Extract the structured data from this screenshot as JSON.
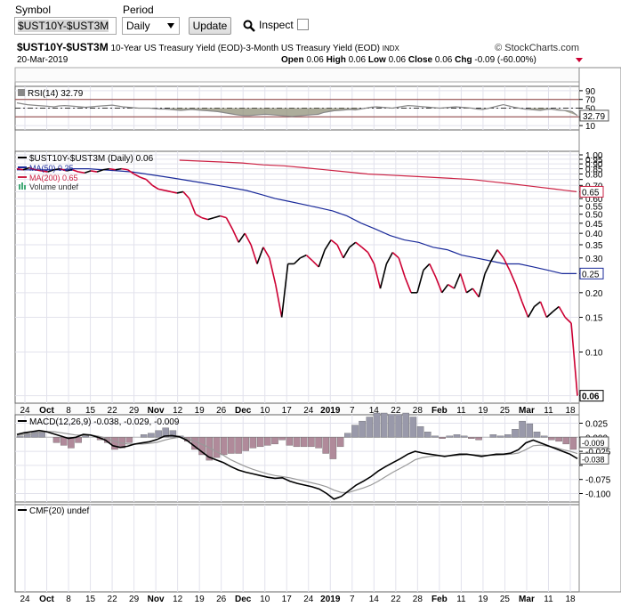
{
  "controls": {
    "symbol_label": "Symbol",
    "symbol_value": "$UST10Y-$UST3M",
    "period_label": "Period",
    "period_value": "Daily",
    "update_label": "Update",
    "inspect_label": "Inspect"
  },
  "header": {
    "symbol": "$UST10Y-$UST3M",
    "description": "10-Year US Treasury Yield (EOD)-3-Month US Treasury Yield (EOD)",
    "exchange": "INDX",
    "brand": "© StockCharts.com",
    "date": "20-Mar-2019",
    "open_label": "Open",
    "open_value": "0.06",
    "high_label": "High",
    "high_value": "0.06",
    "low_label": "Low",
    "low_value": "0.06",
    "close_label": "Close",
    "close_value": "0.06",
    "chg_label": "Chg",
    "chg_value": "-0.09 (-60.00%)"
  },
  "colors": {
    "price": "#000000",
    "price_down": "#cc0033",
    "ma50": "#1a2a9a",
    "ma200": "#cc2244",
    "rsi_line": "#888888",
    "rsi_fill": "#8a8a70",
    "macd_line": "#000000",
    "signal_line": "#999999",
    "hist_pos": "#9999aa",
    "hist_neg": "#b08a9a"
  },
  "chart_data": [
    {
      "type": "line",
      "panel": "RSI",
      "legend": "RSI(14) 32.79",
      "current_label": "32.79",
      "ylim": [
        0,
        100
      ],
      "yticks": [
        "90",
        "70",
        "50",
        "30",
        "10"
      ],
      "reference_lines": [
        70,
        50,
        30
      ],
      "values": [
        62,
        60,
        58,
        57,
        56,
        55,
        54,
        53,
        55,
        56,
        55,
        54,
        53,
        52,
        53,
        54,
        55,
        56,
        57,
        55,
        53,
        52,
        51,
        50,
        50,
        50,
        49,
        48,
        48,
        47,
        46,
        45,
        46,
        47,
        46,
        45,
        44,
        43,
        42,
        40,
        38,
        36,
        34,
        33,
        33,
        34,
        35,
        36,
        35,
        34,
        33,
        32,
        31,
        32,
        33,
        34,
        35,
        36,
        40,
        42,
        44,
        45,
        46,
        47,
        46,
        48,
        50,
        52,
        53,
        52,
        51,
        50,
        52,
        54,
        56,
        55,
        54,
        53,
        52,
        51,
        50,
        51,
        52,
        53,
        52,
        51,
        50,
        48,
        47,
        49,
        52,
        55,
        58,
        55,
        52,
        50,
        48,
        47,
        46,
        45,
        47,
        48,
        46,
        45,
        44,
        42,
        32.79
      ]
    },
    {
      "type": "line",
      "panel": "price",
      "series": [
        {
          "name": "$UST10Y-$UST3M (Daily) 0.06",
          "legend_value": "0.06",
          "values": [
            0.85,
            0.84,
            0.86,
            0.84,
            0.83,
            0.82,
            0.84,
            0.85,
            0.83,
            0.84,
            0.82,
            0.81,
            0.83,
            0.82,
            0.84,
            0.85,
            0.84,
            0.85,
            0.84,
            0.8,
            0.77,
            0.75,
            0.7,
            0.67,
            0.66,
            0.65,
            0.64,
            0.65,
            0.6,
            0.5,
            0.48,
            0.47,
            0.48,
            0.49,
            0.48,
            0.42,
            0.36,
            0.4,
            0.35,
            0.28,
            0.34,
            0.3,
            0.22,
            0.15,
            0.28,
            0.28,
            0.3,
            0.31,
            0.29,
            0.27,
            0.33,
            0.37,
            0.35,
            0.3,
            0.34,
            0.36,
            0.34,
            0.32,
            0.28,
            0.21,
            0.28,
            0.32,
            0.3,
            0.24,
            0.2,
            0.2,
            0.26,
            0.28,
            0.24,
            0.2,
            0.22,
            0.21,
            0.25,
            0.2,
            0.21,
            0.19,
            0.25,
            0.29,
            0.33,
            0.3,
            0.26,
            0.22,
            0.18,
            0.15,
            0.17,
            0.18,
            0.15,
            0.16,
            0.17,
            0.15,
            0.14,
            0.06
          ]
        },
        {
          "name": "MA(50) 0.25",
          "legend_value": "0.25",
          "values": [
            0.84,
            0.84,
            0.84,
            0.84,
            0.85,
            0.85,
            0.84,
            0.83,
            0.82,
            0.8,
            0.78,
            0.76,
            0.74,
            0.72,
            0.7,
            0.68,
            0.66,
            0.63,
            0.6,
            0.58,
            0.56,
            0.54,
            0.52,
            0.49,
            0.45,
            0.42,
            0.39,
            0.37,
            0.36,
            0.34,
            0.33,
            0.31,
            0.3,
            0.29,
            0.28,
            0.28,
            0.27,
            0.26,
            0.25,
            0.25
          ]
        },
        {
          "name": "MA(200) 0.65",
          "legend_value": "0.65",
          "values": [
            0.94,
            0.93,
            0.92,
            0.91,
            0.89,
            0.88,
            0.86,
            0.84,
            0.82,
            0.8,
            0.79,
            0.78,
            0.77,
            0.76,
            0.75,
            0.73,
            0.71,
            0.69,
            0.67,
            0.65
          ]
        },
        {
          "name": "Volume undef"
        }
      ],
      "yticks": [
        "1.00",
        "0.95",
        "0.90",
        "0.85",
        "0.80",
        "0.75",
        "0.70",
        "0.65",
        "0.60",
        "0.55",
        "0.50",
        "0.45",
        "0.40",
        "0.35",
        "0.30",
        "0.25",
        "0.20",
        "0.15",
        "0.10",
        "0.06"
      ],
      "scale": "log"
    },
    {
      "type": "bar",
      "panel": "MACD",
      "legend": "MACD(12,26,9) -0.038, -0.029, -0.009",
      "labels": [
        "-0.009",
        "-0.038"
      ],
      "yticks": [
        "0.025",
        "0.000",
        "-0.025",
        "-0.050",
        "-0.075",
        "-0.100"
      ],
      "ylim": [
        -0.115,
        0.04
      ],
      "macd": [
        0.005,
        0.008,
        0.01,
        0.012,
        0.01,
        0.006,
        0.002,
        -0.002,
        0.0,
        0.005,
        0.004,
        0.0,
        -0.005,
        -0.015,
        -0.018,
        -0.016,
        -0.012,
        -0.01,
        -0.008,
        -0.004,
        0.002,
        0.003,
        0.001,
        -0.005,
        -0.015,
        -0.025,
        -0.035,
        -0.04,
        -0.045,
        -0.052,
        -0.058,
        -0.062,
        -0.065,
        -0.068,
        -0.071,
        -0.073,
        -0.072,
        -0.078,
        -0.082,
        -0.085,
        -0.088,
        -0.092,
        -0.1,
        -0.11,
        -0.105,
        -0.095,
        -0.085,
        -0.078,
        -0.07,
        -0.06,
        -0.052,
        -0.045,
        -0.038,
        -0.03,
        -0.025,
        -0.028,
        -0.03,
        -0.032,
        -0.034,
        -0.032,
        -0.03,
        -0.03,
        -0.032,
        -0.034,
        -0.032,
        -0.03,
        -0.03,
        -0.028,
        -0.022,
        -0.01,
        -0.005,
        -0.01,
        -0.015,
        -0.02,
        -0.025,
        -0.03,
        -0.038
      ],
      "signal": [
        0.004,
        0.005,
        0.006,
        0.008,
        0.01,
        0.01,
        0.008,
        0.006,
        0.004,
        0.004,
        0.004,
        0.002,
        -0.001,
        -0.006,
        -0.01,
        -0.012,
        -0.012,
        -0.012,
        -0.011,
        -0.009,
        -0.005,
        -0.002,
        0.0,
        -0.002,
        -0.006,
        -0.012,
        -0.018,
        -0.025,
        -0.032,
        -0.04,
        -0.046,
        -0.052,
        -0.057,
        -0.061,
        -0.065,
        -0.068,
        -0.07,
        -0.072,
        -0.075,
        -0.078,
        -0.081,
        -0.084,
        -0.088,
        -0.094,
        -0.098,
        -0.098,
        -0.094,
        -0.09,
        -0.085,
        -0.078,
        -0.07,
        -0.062,
        -0.055,
        -0.048,
        -0.04,
        -0.036,
        -0.034,
        -0.033,
        -0.033,
        -0.033,
        -0.032,
        -0.031,
        -0.031,
        -0.032,
        -0.032,
        -0.032,
        -0.031,
        -0.03,
        -0.028,
        -0.022,
        -0.015,
        -0.014,
        -0.016,
        -0.018,
        -0.022,
        -0.025,
        -0.029
      ],
      "histogram": [
        0.001,
        0.003,
        0.004,
        0.004,
        0.0,
        -0.004,
        -0.006,
        -0.008,
        -0.004,
        0.001,
        0.0,
        -0.002,
        -0.004,
        -0.009,
        -0.008,
        -0.004,
        0.0,
        0.002,
        0.003,
        0.005,
        0.007,
        0.005,
        0.001,
        -0.003,
        -0.009,
        -0.013,
        -0.017,
        -0.015,
        -0.013,
        -0.012,
        -0.012,
        -0.01,
        -0.008,
        -0.007,
        -0.006,
        -0.005,
        -0.002,
        -0.006,
        -0.007,
        -0.007,
        -0.007,
        -0.008,
        -0.012,
        -0.016,
        -0.007,
        0.003,
        0.009,
        0.012,
        0.015,
        0.018,
        0.018,
        0.017,
        0.017,
        0.018,
        0.015,
        0.008,
        0.004,
        0.001,
        -0.001,
        0.001,
        0.002,
        0.001,
        -0.001,
        -0.002,
        0.0,
        0.002,
        0.001,
        0.002,
        0.006,
        0.012,
        0.01,
        0.004,
        0.001,
        -0.002,
        -0.003,
        -0.005,
        -0.009
      ]
    },
    {
      "type": "line",
      "panel": "CMF",
      "legend": "CMF(20) undef"
    }
  ],
  "x_axis": {
    "labels": [
      "24",
      "Oct",
      "8",
      "15",
      "22",
      "29",
      "Nov",
      "12",
      "19",
      "26",
      "Dec",
      "10",
      "17",
      "24",
      "2019",
      "7",
      "14",
      "22",
      "28",
      "Feb",
      "11",
      "19",
      "25",
      "Mar",
      "11",
      "18"
    ],
    "bold": [
      "Oct",
      "Nov",
      "Dec",
      "2019",
      "Feb",
      "Mar"
    ]
  }
}
